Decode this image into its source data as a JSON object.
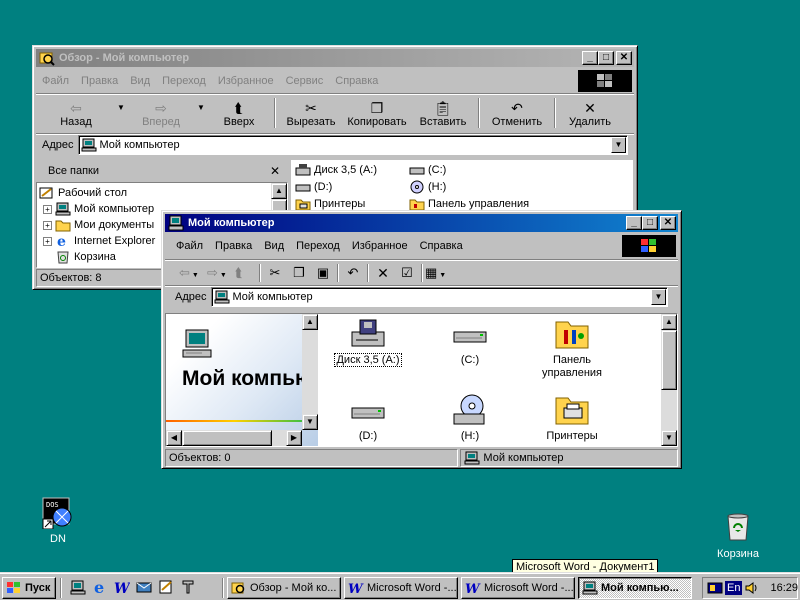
{
  "back_window": {
    "title": "Обзор - Мой компьютер",
    "menu": [
      "Файл",
      "Правка",
      "Вид",
      "Переход",
      "Избранное",
      "Сервис",
      "Справка"
    ],
    "toolbar": {
      "back": "Назад",
      "forward": "Вперед",
      "up": "Вверх",
      "cut": "Вырезать",
      "copy": "Копировать",
      "paste": "Вставить",
      "undo": "Отменить",
      "delete": "Удалить"
    },
    "address_label": "Адрес",
    "address_value": "Мой компьютер",
    "folders_title": "Все папки",
    "tree": [
      "Рабочий стол",
      "Мой компьютер",
      "Мои документы",
      "Internet Explorer",
      "Корзина"
    ],
    "right_items": [
      "Диск 3,5 (A:)",
      "(C:)",
      "(D:)",
      "(H:)",
      "Принтеры",
      "Панель управления"
    ],
    "status": "Объектов: 8"
  },
  "front_window": {
    "title": "Мой компьютер",
    "menu": [
      "Файл",
      "Правка",
      "Вид",
      "Переход",
      "Избранное",
      "Справка"
    ],
    "address_label": "Адрес",
    "address_value": "Мой компьютер",
    "banner_title": "Мой компьюте",
    "icons": [
      "Диск 3,5 (A:)",
      "(C:)",
      "Панель управления",
      "(D:)",
      "(H:)",
      "Принтеры"
    ],
    "status_left": "Объектов: 0",
    "status_right": "Мой компьютер"
  },
  "desktop": {
    "icons": [
      "DN",
      "Корзина"
    ]
  },
  "tooltip": "Microsoft Word - Документ1",
  "taskbar": {
    "start": "Пуск",
    "buttons": [
      "Обзор - Мой ко...",
      "Microsoft Word -...",
      "Microsoft Word -...",
      "Мой компью..."
    ],
    "lang": "En",
    "clock": "16:29"
  }
}
